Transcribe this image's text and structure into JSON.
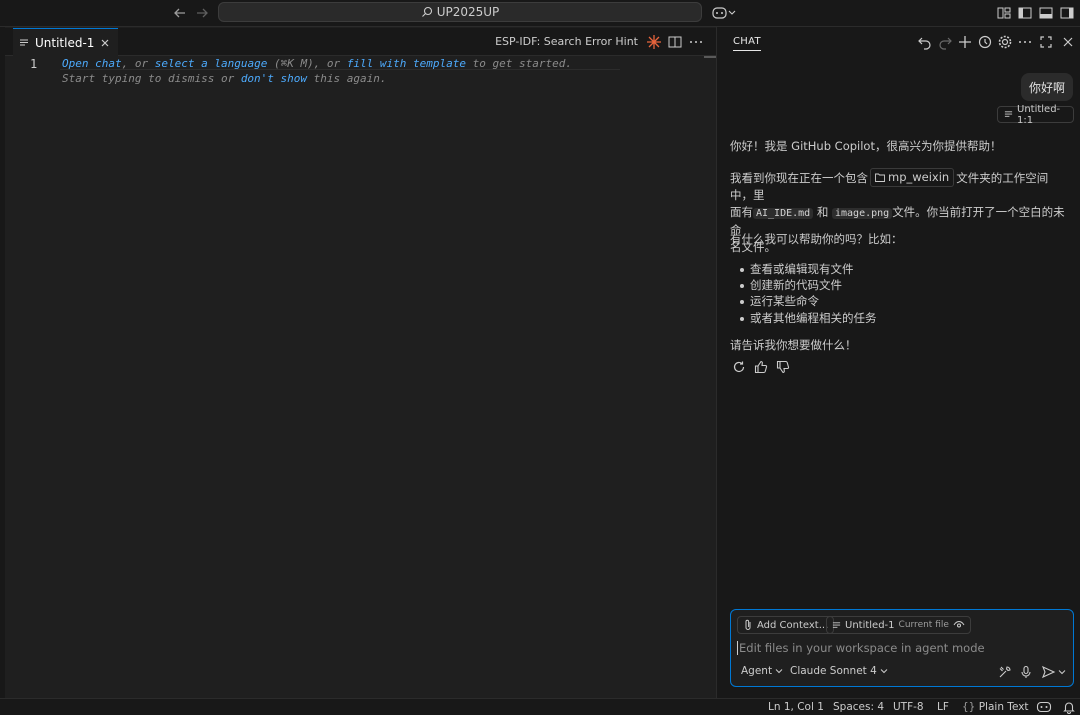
{
  "titlebar": {
    "search_text": "UP2025UP"
  },
  "editor": {
    "tab_label": "Untitled-1",
    "esp_hint": "ESP-IDF: Search Error Hint",
    "line_number": "1",
    "hint": {
      "open_chat": "Open chat",
      "sep1": ", or ",
      "select_language": "select a language",
      "shortcut": " (⌘K M), or ",
      "fill_template": "fill with template",
      "suffix1": " to get started.",
      "start_typing": "Start typing to dismiss or ",
      "dont_show": "don't show",
      "suffix2": " this again."
    }
  },
  "chat": {
    "title": "CHAT",
    "user_message": "你好啊",
    "user_reference": "Untitled-1:1",
    "reply": {
      "greeting": "你好！我是 GitHub Copilot，很高兴为你提供帮助！",
      "p2_start": "我看到你现在正在一个包含",
      "folder": "mp_weixin",
      "p2_mid1": "文件夹的工作空间中，里",
      "p2_mid2_a": "面有",
      "file1": "AI_IDE.md",
      "p2_and": "和",
      "file2": "image.png",
      "p2_end": "文件。你当前打开了一个空白的未命",
      "p2_end2": "名文件。",
      "question": "有什么我可以帮助你的吗？比如：",
      "bullets": [
        "查看或编辑现有文件",
        "创建新的代码文件",
        "运行某些命令",
        "或者其他编程相关的任务"
      ],
      "closing": "请告诉我你想要做什么！"
    },
    "input": {
      "add_context": "Add Context...",
      "current_file_name": "Untitled-1",
      "current_file_tag": "Current file",
      "placeholder": "Edit files in your workspace in agent mode",
      "mode": "Agent",
      "model": "Claude Sonnet 4"
    }
  },
  "statusbar": {
    "position": "Ln 1, Col 1",
    "spaces": "Spaces: 4",
    "encoding": "UTF-8",
    "eol": "LF",
    "language": "Plain Text"
  },
  "colors": {
    "accent": "#0078d4",
    "link": "#4daafc",
    "background": "#1f1f1f"
  }
}
